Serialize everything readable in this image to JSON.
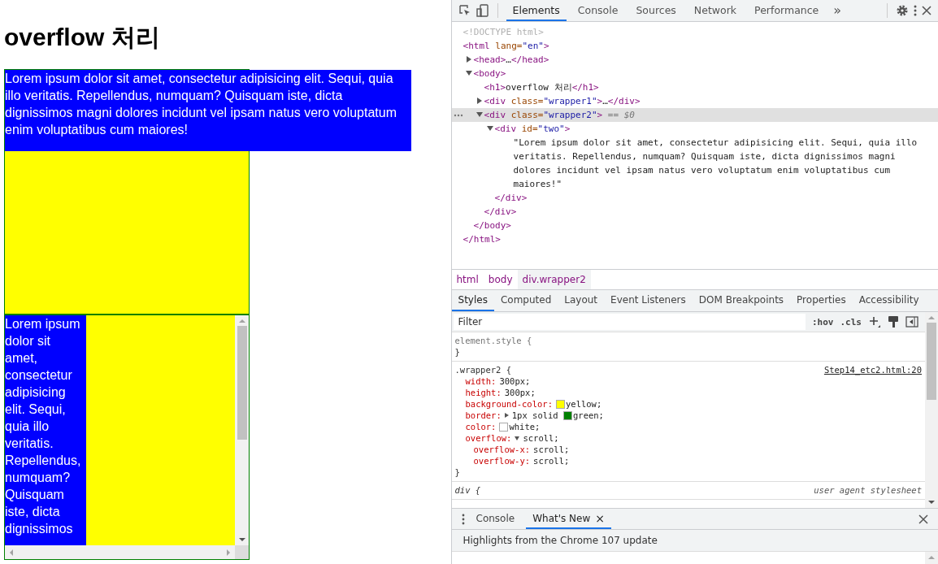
{
  "page": {
    "heading": "overflow 처리",
    "wrapper1": {
      "text": "Lorem ipsum dolor sit amet, consectetur adipisicing elit. Sequi, quia illo veritatis. Repellendus, numquam? Quisquam iste, dicta dignissimos magni dolores incidunt vel ipsam natus vero voluptatum enim voluptatibus cum maiores!"
    },
    "wrapper2": {
      "text": "Lorem ipsum dolor sit amet, consectetur adipisicing elit. Sequi, quia illo veritatis. Repellendus, numquam? Quisquam iste, dicta dignissimos"
    }
  },
  "devtools": {
    "tabs": [
      {
        "label": "Elements",
        "selected": true
      },
      {
        "label": "Console",
        "selected": false
      },
      {
        "label": "Sources",
        "selected": false
      },
      {
        "label": "Network",
        "selected": false
      },
      {
        "label": "Performance",
        "selected": false
      }
    ],
    "more_tabs": "»",
    "dom_tree": [
      {
        "selected": false,
        "parts": [
          {
            "kind": "doctype",
            "text": "<!DOCTYPE html>"
          }
        ]
      },
      {
        "selected": false,
        "parts": [
          {
            "kind": "tag",
            "text": "<html"
          },
          {
            "kind": "attr",
            "text": " lang="
          },
          {
            "kind": "value",
            "text": "\"en\""
          },
          {
            "kind": "tag",
            "text": ">"
          }
        ],
        "close": [
          {
            "kind": "tag",
            "text": "</html>"
          }
        ],
        "children": [
          {
            "selected": false,
            "expanded": false,
            "parts": [
              {
                "kind": "tag",
                "text": "<head>"
              },
              {
                "kind": "text",
                "text": "…"
              },
              {
                "kind": "tag",
                "text": "</head>"
              }
            ]
          },
          {
            "selected": false,
            "expanded": true,
            "parts": [
              {
                "kind": "tag",
                "text": "<body>"
              }
            ],
            "close": [
              {
                "kind": "tag",
                "text": "</body>"
              }
            ],
            "children": [
              {
                "selected": false,
                "parts": [
                  {
                    "kind": "tag",
                    "text": "<h1>"
                  },
                  {
                    "kind": "text",
                    "text": "overflow 처리"
                  },
                  {
                    "kind": "tag",
                    "text": "</h1>"
                  }
                ]
              },
              {
                "selected": false,
                "expanded": false,
                "parts": [
                  {
                    "kind": "tag",
                    "text": "<div"
                  },
                  {
                    "kind": "attr",
                    "text": " class="
                  },
                  {
                    "kind": "value",
                    "text": "\"wrapper1\""
                  },
                  {
                    "kind": "tag",
                    "text": ">"
                  },
                  {
                    "kind": "text",
                    "text": "…"
                  },
                  {
                    "kind": "tag",
                    "text": "</div>"
                  }
                ]
              },
              {
                "selected": true,
                "expanded": true,
                "parts": [
                  {
                    "kind": "tag",
                    "text": "<div"
                  },
                  {
                    "kind": "attr",
                    "text": " class="
                  },
                  {
                    "kind": "value",
                    "text": "\"wrapper2\""
                  },
                  {
                    "kind": "tag",
                    "text": ">"
                  },
                  {
                    "kind": "note",
                    "text": " == $0"
                  }
                ],
                "close": [
                  {
                    "kind": "tag",
                    "text": "</div>"
                  }
                ],
                "children": [
                  {
                    "selected": false,
                    "expanded": true,
                    "parts": [
                      {
                        "kind": "tag",
                        "text": "<div"
                      },
                      {
                        "kind": "attr",
                        "text": " id="
                      },
                      {
                        "kind": "value",
                        "text": "\"two\""
                      },
                      {
                        "kind": "tag",
                        "text": ">"
                      }
                    ],
                    "close": [
                      {
                        "kind": "tag",
                        "text": "</div>"
                      }
                    ],
                    "children": [
                      {
                        "selected": false,
                        "parts": [
                          {
                            "kind": "text",
                            "text": "\"Lorem ipsum dolor sit amet, consectetur adipisicing elit. Sequi, quia illo veritatis. Repellendus, numquam? Quisquam iste, dicta dignissimos magni dolores incidunt vel ipsam natus vero voluptatum enim voluptatibus cum maiores!\""
                          }
                        ]
                      }
                    ]
                  }
                ]
              }
            ]
          }
        ]
      }
    ],
    "breadcrumbs": [
      {
        "label": "html",
        "selected": false
      },
      {
        "label": "body",
        "selected": false
      },
      {
        "label": "div.wrapper2",
        "selected": true
      }
    ],
    "style_tabs": [
      {
        "label": "Styles",
        "selected": true
      },
      {
        "label": "Computed",
        "selected": false
      },
      {
        "label": "Layout",
        "selected": false
      },
      {
        "label": "Event Listeners",
        "selected": false
      },
      {
        "label": "DOM Breakpoints",
        "selected": false
      },
      {
        "label": "Properties",
        "selected": false
      },
      {
        "label": "Accessibility",
        "selected": false
      }
    ],
    "filter": {
      "placeholder": "Filter"
    },
    "filter_buttons": [
      ":hov",
      ".cls"
    ],
    "rules": [
      {
        "kind": "inline",
        "selector": "element.style {",
        "close": "}"
      },
      {
        "kind": "author",
        "selector": ".wrapper2 {",
        "source": "Step14_etc2.html:20",
        "close": "}",
        "declarations": [
          {
            "name": "width:",
            "value": "300px;"
          },
          {
            "name": "height:",
            "value": "300px;"
          },
          {
            "name": "background-color:",
            "color": "#ffff00",
            "value": "yellow;"
          },
          {
            "name": "border:",
            "expanded": false,
            "value": "1px solid ",
            "color": "#008000",
            "value2": "green;"
          },
          {
            "name": "color:",
            "color": "#ffffff",
            "value": "white;"
          },
          {
            "name": "overflow:",
            "expanded": true,
            "value": "scroll;",
            "children": [
              {
                "name": "overflow-x:",
                "value": "scroll;"
              },
              {
                "name": "overflow-y:",
                "value": "scroll;"
              }
            ]
          }
        ]
      },
      {
        "kind": "useragent",
        "selector": "div {",
        "source": "user agent stylesheet"
      }
    ],
    "drawer": {
      "tabs": [
        {
          "label": "Console",
          "selected": false,
          "closable": false
        },
        {
          "label": "What's New",
          "selected": true,
          "closable": true
        }
      ],
      "close_glyph": "×",
      "headline": "Highlights from the Chrome 107 update"
    }
  }
}
